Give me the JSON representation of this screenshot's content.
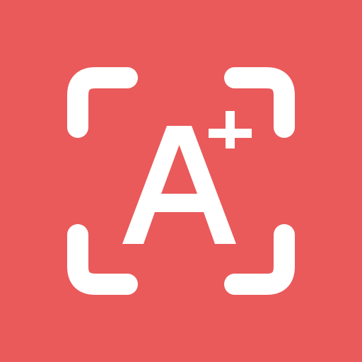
{
  "app_icon": {
    "name": "A+ scanner icon",
    "icon": "scan-frame-grade-icon",
    "glyph": "A",
    "superscript": "+",
    "colors": {
      "background": "#ea5a5b",
      "foreground": "#ffffff"
    }
  }
}
